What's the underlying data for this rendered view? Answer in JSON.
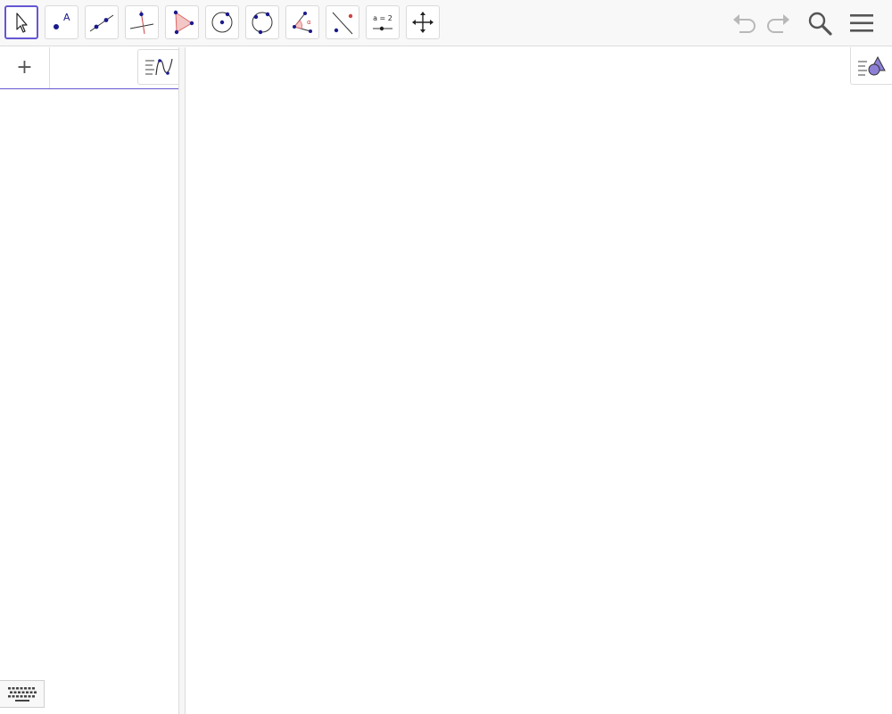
{
  "toolbar": {
    "tools": [
      {
        "name": "move-tool",
        "selected": true
      },
      {
        "name": "point-tool",
        "label": "A"
      },
      {
        "name": "line-tool"
      },
      {
        "name": "perpendicular-line-tool"
      },
      {
        "name": "polygon-tool"
      },
      {
        "name": "circle-center-point-tool"
      },
      {
        "name": "circle-three-points-tool"
      },
      {
        "name": "angle-tool"
      },
      {
        "name": "reflect-about-line-tool"
      },
      {
        "name": "slider-tool",
        "label": "a = 2"
      },
      {
        "name": "move-graphics-view-tool"
      }
    ],
    "undo_icon": "undo-icon",
    "redo_icon": "redo-icon",
    "search_icon": "search-icon",
    "menu_icon": "hamburger-menu-icon"
  },
  "algebra": {
    "add_label": "+",
    "style_icon": "algebra-style-icon"
  },
  "graphics": {
    "style_icon": "graphics-style-icon"
  },
  "keyboard": {
    "icon": "keyboard-icon"
  },
  "colors": {
    "accent": "#6557d2",
    "point": "#1a1a8c",
    "polygon_fill": "#f4c7c7",
    "polygon_stroke": "#d66",
    "toolbar_bg": "#f8f8f8"
  }
}
